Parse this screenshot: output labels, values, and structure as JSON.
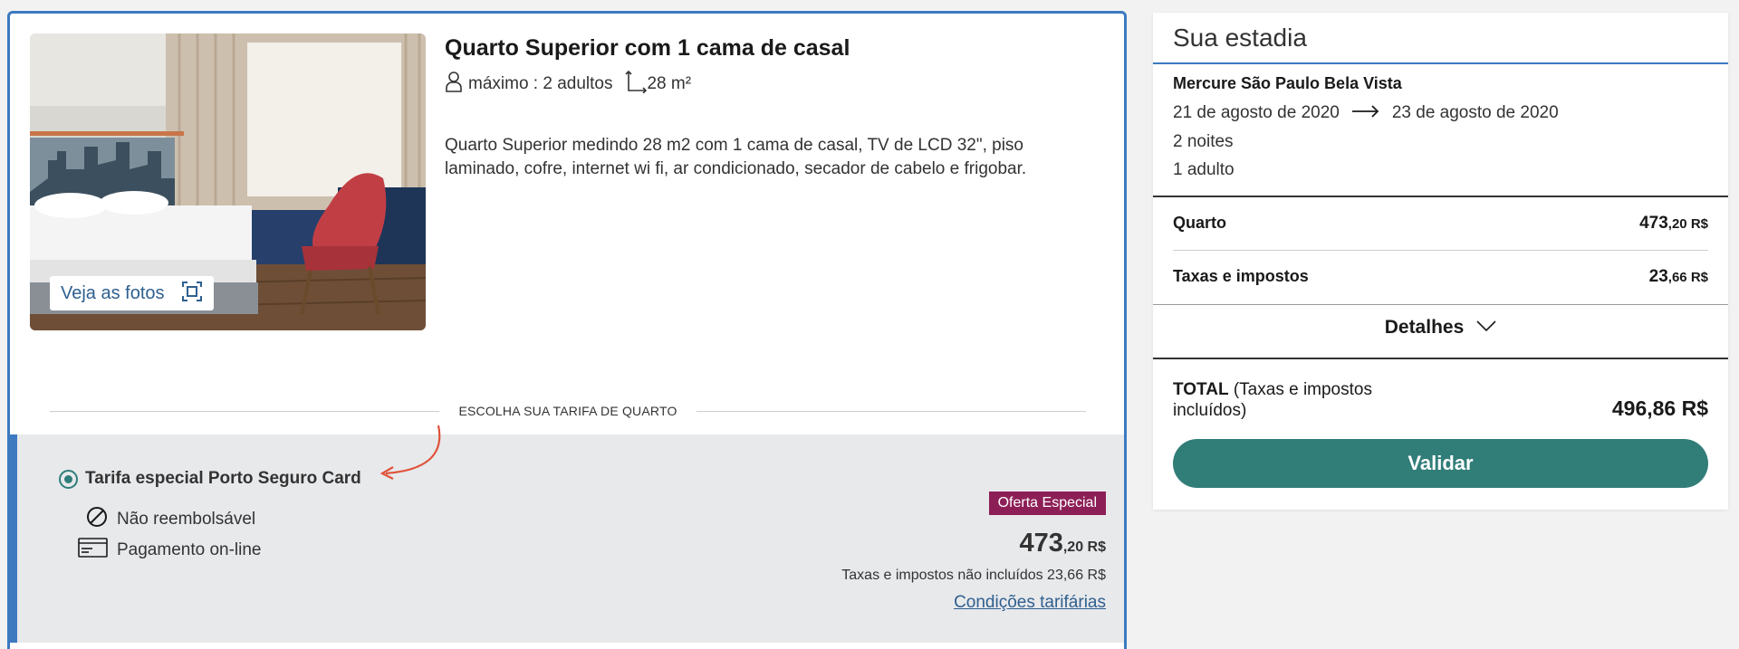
{
  "room": {
    "title": "Quarto Superior com 1 cama de casal",
    "capacity": "máximo : 2 adultos",
    "area": "28 m²",
    "description": "Quarto Superior medindo 28 m2 com 1 cama de casal, TV de LCD 32\", piso laminado, cofre, internet wi fi, ar condicionado, secador de cabelo e frigobar.",
    "photos_button": "Veja as fotos"
  },
  "rate_section": {
    "heading": "ESCOLHA SUA TARIFA DE QUARTO",
    "rate": {
      "name": "Tarifa especial Porto Seguro Card",
      "selected": true,
      "conditions": [
        "Não reembolsável",
        "Pagamento on-line"
      ],
      "badge": "Oferta Especial",
      "price_int": "473",
      "price_dec": ",20 R$",
      "tax_note": "Taxas e impostos não incluídos 23,66 R$",
      "link": "Condições tarifárias"
    }
  },
  "summary": {
    "title": "Sua estadia",
    "hotel": "Mercure São Paulo Bela Vista",
    "checkin": "21 de agosto de 2020",
    "checkout": "23 de agosto de 2020",
    "nights": "2 noites",
    "guests": "1 adulto",
    "room_label": "Quarto",
    "room_price_int": "473",
    "room_price_dec": ",20 R$",
    "tax_label": "Taxas e impostos",
    "tax_price_int": "23",
    "tax_price_dec": ",66 R$",
    "details_label": "Detalhes",
    "total_label": "TOTAL",
    "total_note": "(Taxas e impostos incluídos)",
    "total_value": "496,86 R$",
    "validate_button": "Validar"
  },
  "colors": {
    "accent_blue": "#3d7ac0",
    "button_teal": "#317d78",
    "badge": "#8d1f57",
    "link": "#2e5f8f"
  }
}
